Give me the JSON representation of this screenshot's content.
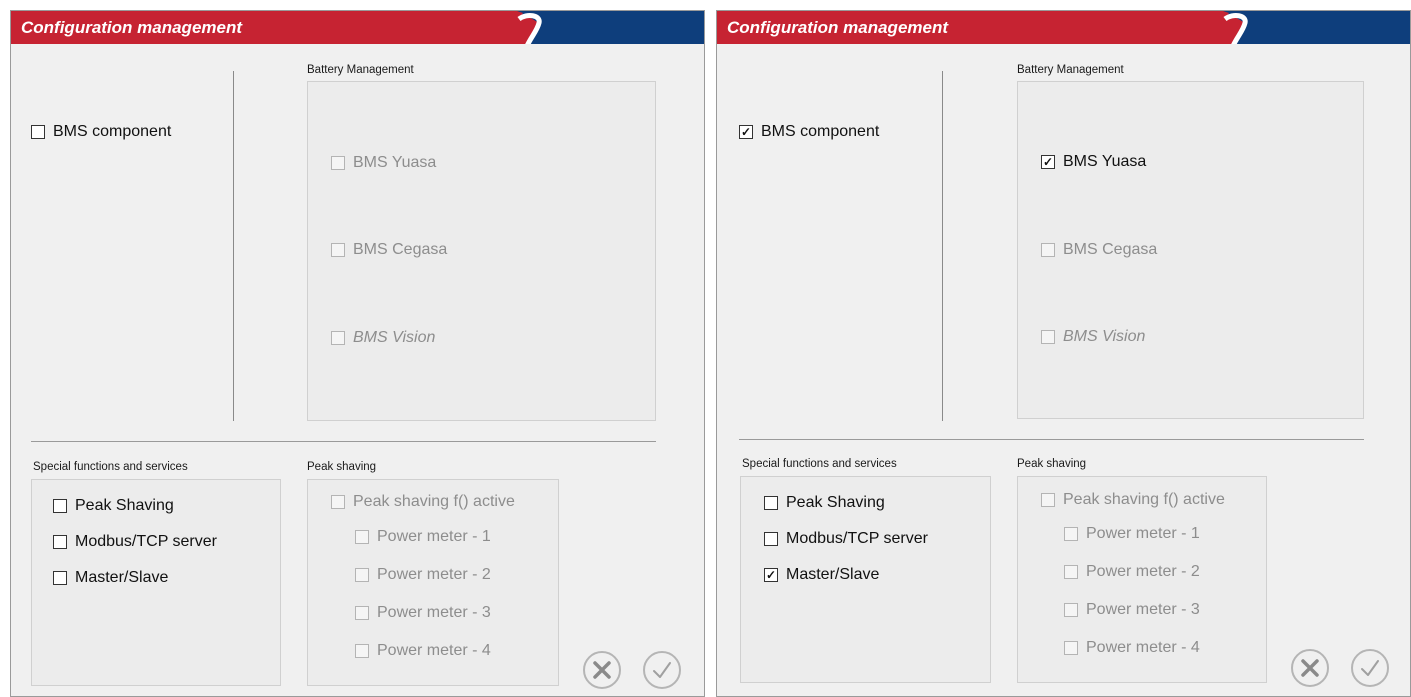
{
  "panels": [
    {
      "title": "Configuration management",
      "bms_component": {
        "label": "BMS component",
        "checked": false
      },
      "battery_management": {
        "label": "Battery Management",
        "items": [
          {
            "label": "BMS Yuasa",
            "checked": false,
            "enabled": false
          },
          {
            "label": "BMS Cegasa",
            "checked": false,
            "enabled": false
          },
          {
            "label": "BMS Vision",
            "checked": false,
            "enabled": false
          }
        ]
      },
      "special_functions": {
        "label": "Special functions and services",
        "items": [
          {
            "label": "Peak Shaving",
            "checked": false
          },
          {
            "label": "Modbus/TCP server",
            "checked": false
          },
          {
            "label": "Master/Slave",
            "checked": false
          }
        ]
      },
      "peak_shaving": {
        "label": "Peak shaving",
        "active": {
          "label": "Peak shaving f() active",
          "checked": false
        },
        "meters": [
          {
            "label": "Power meter - 1"
          },
          {
            "label": "Power meter - 2"
          },
          {
            "label": "Power meter - 3"
          },
          {
            "label": "Power meter - 4"
          }
        ]
      }
    },
    {
      "title": "Configuration management",
      "bms_component": {
        "label": "BMS component",
        "checked": true
      },
      "battery_management": {
        "label": "Battery Management",
        "items": [
          {
            "label": "BMS Yuasa",
            "checked": true,
            "enabled": true
          },
          {
            "label": "BMS Cegasa",
            "checked": false,
            "enabled": false
          },
          {
            "label": "BMS Vision",
            "checked": false,
            "enabled": false
          }
        ]
      },
      "special_functions": {
        "label": "Special functions and services",
        "items": [
          {
            "label": "Peak Shaving",
            "checked": false
          },
          {
            "label": "Modbus/TCP server",
            "checked": false
          },
          {
            "label": "Master/Slave",
            "checked": true
          }
        ]
      },
      "peak_shaving": {
        "label": "Peak shaving",
        "active": {
          "label": "Peak shaving f() active",
          "checked": false
        },
        "meters": [
          {
            "label": "Power meter - 1"
          },
          {
            "label": "Power meter - 2"
          },
          {
            "label": "Power meter - 3"
          },
          {
            "label": "Power meter - 4"
          }
        ]
      }
    }
  ],
  "icons": {
    "cancel": "cancel-icon",
    "confirm": "confirm-icon"
  },
  "colors": {
    "title_red": "#c62332",
    "title_blue": "#0e3e7c"
  }
}
